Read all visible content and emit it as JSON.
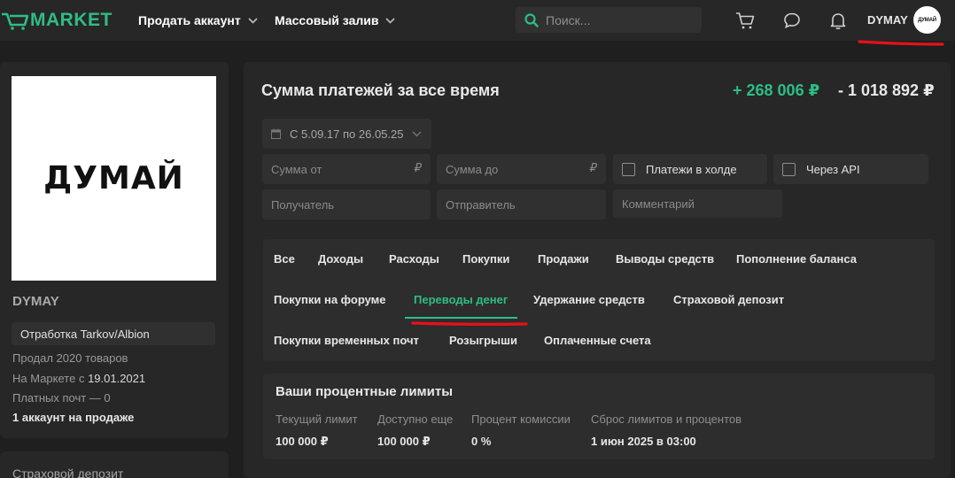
{
  "header": {
    "logo_text": "MARKET",
    "nav": [
      {
        "label": "Продать аккаунт"
      },
      {
        "label": "Массовый залив"
      }
    ],
    "search_placeholder": "Поиск...",
    "username": "DYMAY",
    "avatar_text": "ДУМАЙ"
  },
  "sidebar": {
    "avatar_text": "ДУМАЙ",
    "name": "DYMAY",
    "tag": "Отработка Tarkov/Albion",
    "sold": "Продал 2020 товаров",
    "market_since_prefix": "На Маркете с ",
    "market_since_date": "19.01.2021",
    "paid_mails": "Платных почт — 0",
    "accounts_for_sale": "1 аккаунт на продаже",
    "deposit_title": "Страховой депозит"
  },
  "main": {
    "title": "Сумма платежей за все время",
    "sum_in": "+ 268 006 ₽",
    "sum_out": "- 1 018 892 ₽",
    "date_range": "С 5.09.17 по 26.05.25",
    "sum_from_placeholder": "Сумма от",
    "sum_to_placeholder": "Сумма до",
    "currency_symbol": "₽",
    "hold_label": "Платежи в холде",
    "api_label": "Через API",
    "recipient_placeholder": "Получатель",
    "sender_placeholder": "Отправитель",
    "comment_placeholder": "Комментарий"
  },
  "tabs": {
    "all": "Все",
    "income": "Доходы",
    "expenses": "Расходы",
    "purchases": "Покупки",
    "sales": "Продажи",
    "withdrawals": "Выводы средств",
    "topup": "Пополнение баланса",
    "forum_purchases": "Покупки на форуме",
    "transfers": "Переводы денег",
    "holds": "Удержание средств",
    "insurance": "Страховой депозит",
    "temp_mail": "Покупки временных почт",
    "giveaways": "Розыгрыши",
    "paid_invoices": "Оплаченные счета",
    "active": "transfers"
  },
  "limits": {
    "title": "Ваши процентные лимиты",
    "columns": [
      {
        "label": "Текущий лимит",
        "value": "100 000 ₽"
      },
      {
        "label": "Доступно еще",
        "value": "100 000 ₽"
      },
      {
        "label": "Процент комиссии",
        "value": "0 %"
      },
      {
        "label": "Сброс лимитов и процентов",
        "value": "1 июн 2025 в 03:00"
      }
    ]
  },
  "colors": {
    "accent": "#2ebd85",
    "background": "#1f1f1f",
    "panel": "#272727",
    "annotation_red": "#e8101a"
  }
}
